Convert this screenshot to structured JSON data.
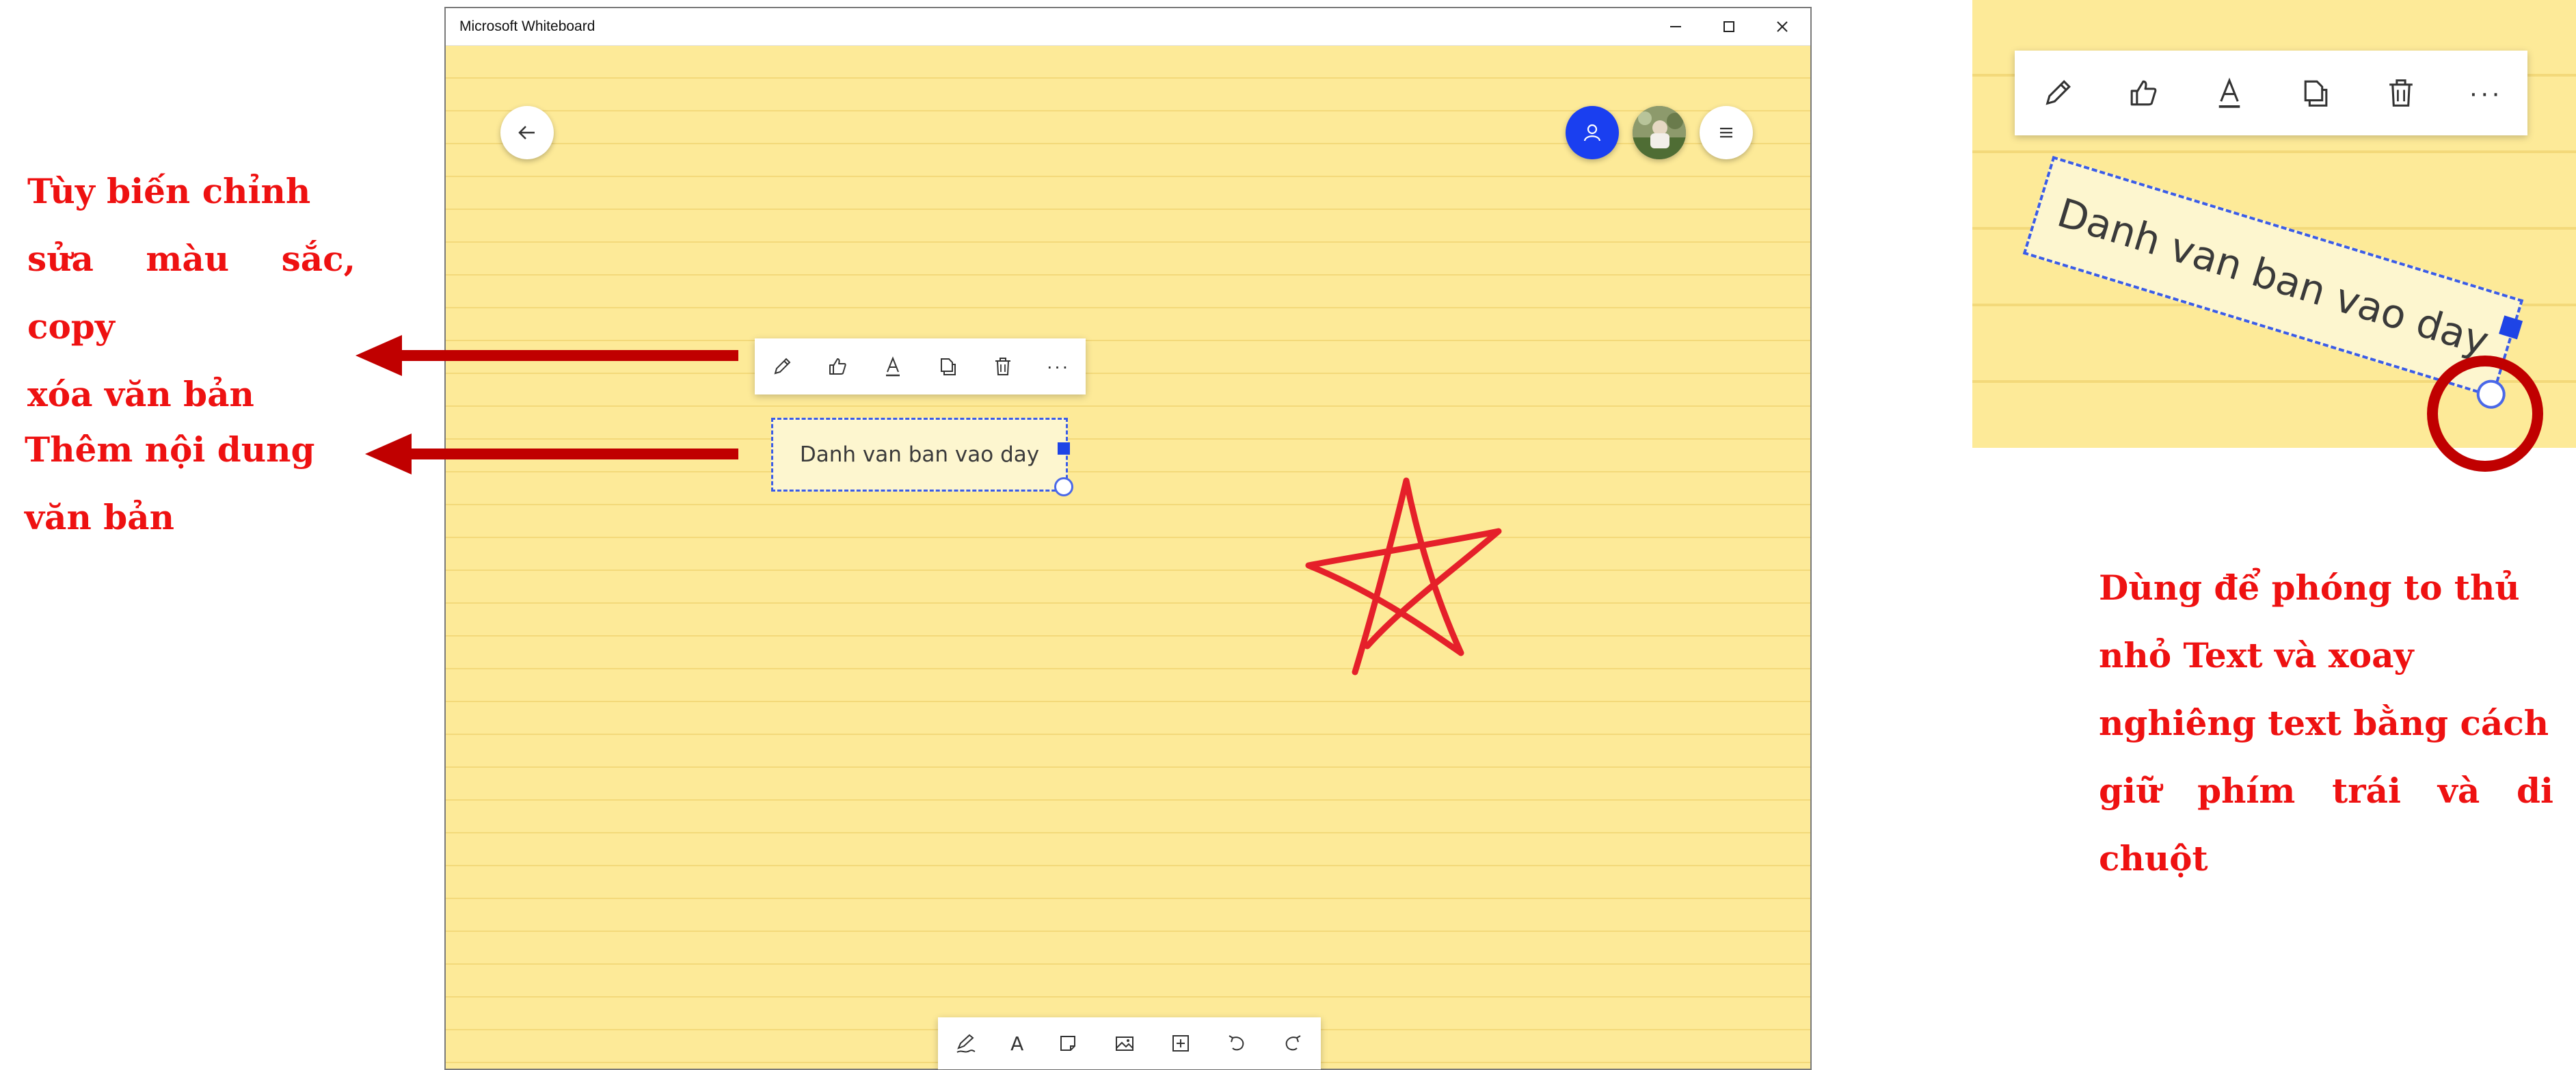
{
  "window": {
    "title": "Microsoft Whiteboard",
    "controls": [
      "minimize",
      "maximize",
      "close"
    ]
  },
  "canvas": {
    "background": "#fdea98",
    "header_buttons": [
      "back-arrow-icon",
      "invite-person-icon",
      "user-avatar",
      "hamburger-menu-icon"
    ],
    "avatar_color": "#1a3ff0"
  },
  "context_toolbar": {
    "items": [
      "pencil-icon",
      "thumbs-up-icon",
      "text-color-icon",
      "copy-icon",
      "trash-icon",
      "more-icon"
    ],
    "more_label": "···"
  },
  "text_note": {
    "text": "Danh van ban vao day",
    "border_color": "#3a5ce8"
  },
  "drawing": {
    "shape": "star",
    "ink_color": "#e5202a"
  },
  "bottom_toolbar": {
    "items": [
      "pen-icon",
      "text-icon",
      "sticky-note-icon",
      "image-icon",
      "insert-icon",
      "undo-icon",
      "redo-icon"
    ],
    "text_tool_label": "A"
  },
  "annotations": {
    "toolbar_note": [
      "Tùy biến chỉnh",
      "sửa màu sắc, copy",
      "xóa văn bản"
    ],
    "add_text_note": [
      "Thêm nội dung",
      "văn bản"
    ],
    "resize_note": [
      "Dùng để phóng to thủ",
      "nhỏ Text và xoay",
      "nghiêng text bằng cách",
      "giữ phím trái và di chuột"
    ],
    "annotation_color": "#ee1111",
    "arrow_color": "#c00000"
  },
  "zoom_inset": {
    "note_text": "Danh van ban vao day",
    "highlight_color": "#c00000"
  }
}
